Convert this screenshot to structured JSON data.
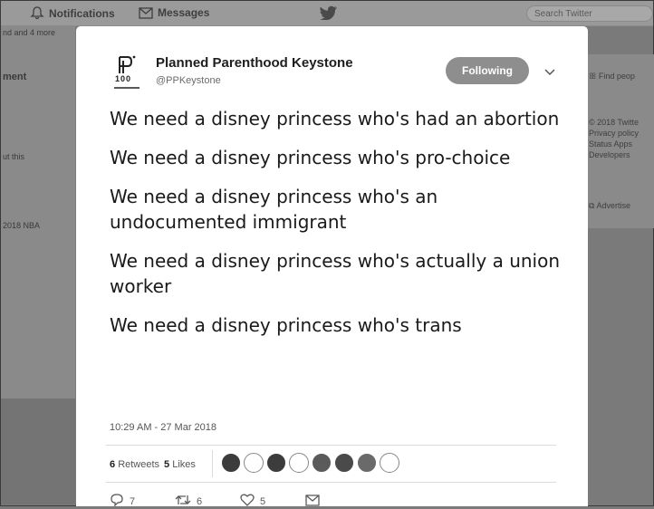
{
  "nav": {
    "notifications_label": "Notifications",
    "messages_label": "Messages",
    "search_placeholder": "Search Twitter"
  },
  "left_col": {
    "line1": "nd and 4 more",
    "heading": "ment",
    "line2": "ut this",
    "line3": "2018 NBA"
  },
  "right_col": {
    "find_people": "Find peop",
    "footer_lines": [
      "© 2018 Twitte",
      "Privacy policy",
      "Status  Apps",
      "Developers"
    ],
    "advertise": "Advertise"
  },
  "tweet": {
    "author_name": "Planned Parenthood Keystone",
    "author_handle": "@PPKeystone",
    "avatar_badge": "100",
    "follow_label": "Following",
    "paragraphs": [
      "We need a disney princess who's had an abortion",
      "We need a disney princess who's pro-choice",
      "We need a disney princess who's an undocumented immigrant",
      "We need a disney princess who's actually a union worker",
      "We need a disney princess who's trans"
    ],
    "timestamp": "10:29 AM - 27 Mar 2018",
    "retweets_count": "6",
    "retweets_label": "Retweets",
    "likes_count": "5",
    "likes_label": "Likes",
    "reply_count": "7",
    "retweet_count": "6",
    "like_count": "5"
  }
}
